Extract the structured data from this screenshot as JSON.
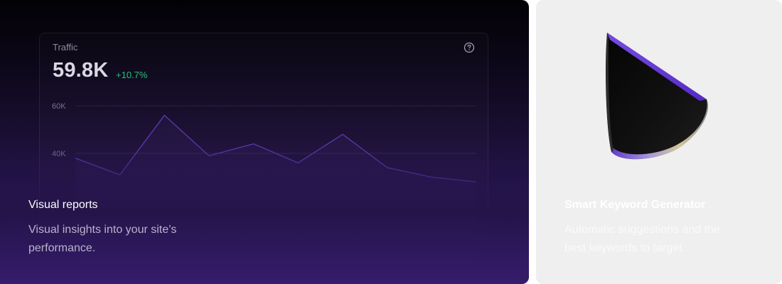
{
  "visual_reports": {
    "widget_title": "Traffic",
    "value": "59.8K",
    "change": "+10.7%",
    "feature_title": "Visual reports",
    "feature_description": "Visual insights into your site’s performance."
  },
  "chart_data": {
    "type": "line",
    "y_ticks": [
      "60K",
      "40K"
    ],
    "ylim": [
      0,
      60000
    ],
    "x": [
      1,
      2,
      3,
      4,
      5,
      6,
      7,
      8,
      9,
      10
    ],
    "values": [
      38000,
      31000,
      56000,
      39000,
      44000,
      36000,
      48000,
      34000,
      30000,
      28000
    ],
    "grid": true
  },
  "keyword_generator": {
    "feature_title": "Smart Keyword Generator",
    "feature_description": "Automatic suggestions and the best keywords to target."
  },
  "colors": {
    "accent_green": "#23c27a",
    "line_purple": "#5b37a8"
  },
  "icons": {
    "help": "question-circle-icon"
  }
}
